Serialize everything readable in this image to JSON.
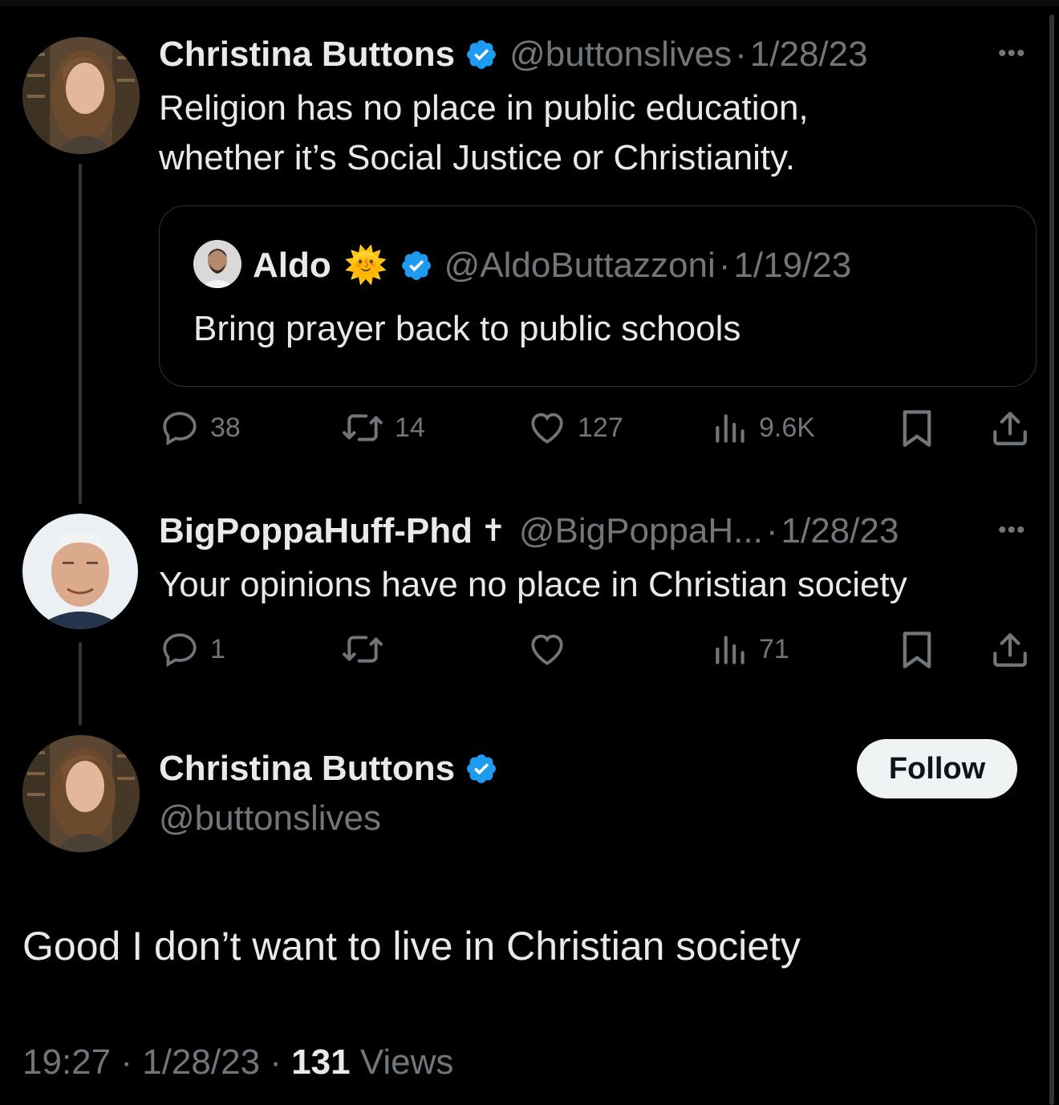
{
  "tweet1": {
    "name": "Christina Buttons",
    "handle": "@buttonslives",
    "separator": "·",
    "date": "1/28/23",
    "more": "•••",
    "text_line1": "Religion has no place in public education,",
    "text_line2": "whether it’s Social Justice or Christianity.",
    "quote": {
      "name": "Aldo",
      "emoji": "🌞",
      "handle": "@AldoButtazzoni",
      "separator": "·",
      "date": "1/19/23",
      "text": "Bring prayer back to public schools"
    },
    "actions": {
      "replies": "38",
      "retweets": "14",
      "likes": "127",
      "views": "9.6K"
    }
  },
  "tweet2": {
    "name": "BigPoppaHuff-Phd",
    "emoji": "✝",
    "handle": "@BigPoppaH...",
    "separator": "·",
    "date": "1/28/23",
    "more": "•••",
    "text": "Your opinions have no place in Christian society",
    "actions": {
      "replies": "1",
      "views": "71"
    }
  },
  "main_tweet": {
    "name": "Christina Buttons",
    "handle": "@buttonslives",
    "follow_label": "Follow",
    "text": "Good I don’t want to live in Christian society",
    "time": "19:27",
    "separator": "·",
    "date": "1/28/23",
    "views_count": "131",
    "views_label": "Views"
  },
  "colors": {
    "background": "#000000",
    "text": "#e7e9ea",
    "secondary": "#71767b",
    "verified": "#1d9bf0",
    "border": "#2f3336"
  }
}
